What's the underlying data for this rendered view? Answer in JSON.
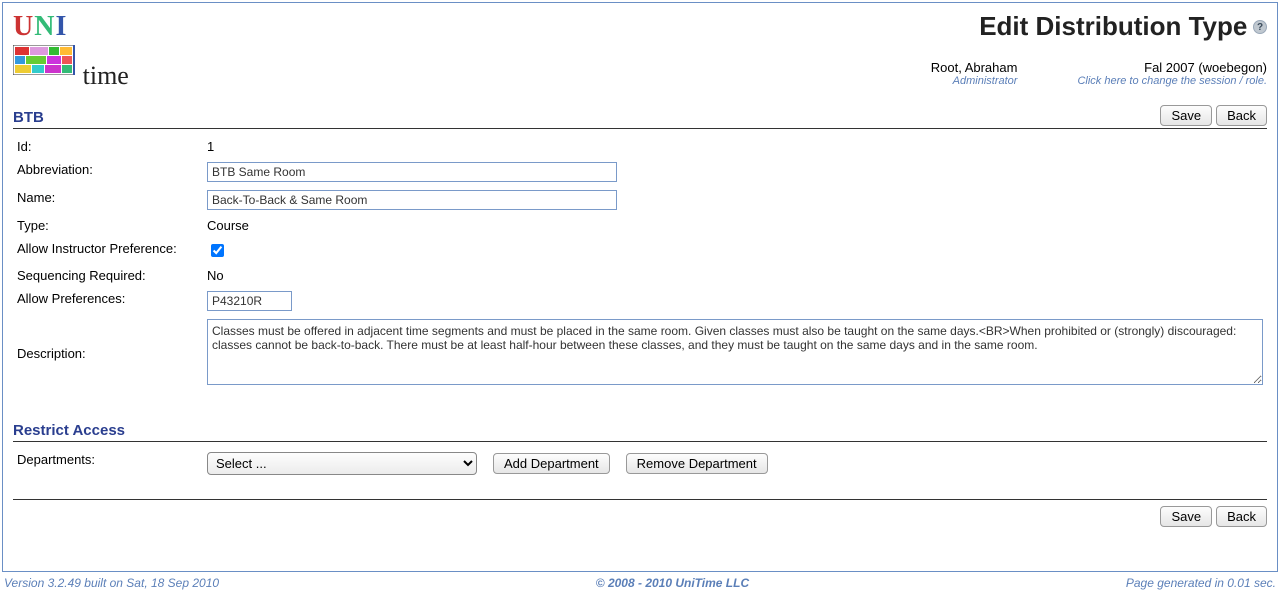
{
  "header": {
    "logo_letters": {
      "u": "U",
      "n": "N",
      "i": "I"
    },
    "time_word": "time",
    "page_title": "Edit Distribution Type",
    "help_glyph": "?",
    "user_name": "Root, Abraham",
    "user_role": "Administrator",
    "session_label": "Fal 2007 (woebegon)",
    "session_hint": "Click here to change the session / role."
  },
  "section": {
    "title": "BTB",
    "save_label": "Save",
    "back_label": "Back"
  },
  "form": {
    "id_label": "Id:",
    "id_value": "1",
    "abbr_label": "Abbreviation:",
    "abbr_value": "BTB Same Room",
    "name_label": "Name:",
    "name_value": "Back-To-Back & Same Room",
    "type_label": "Type:",
    "type_value": "Course",
    "allow_ipr_label": "Allow Instructor Preference:",
    "allow_ipr_checked": true,
    "seq_label": "Sequencing Required:",
    "seq_value": "No",
    "allow_prefs_label": "Allow Preferences:",
    "allow_prefs_value": "P43210R",
    "desc_label": "Description:",
    "desc_value": "Classes must be offered in adjacent time segments and must be placed in the same room. Given classes must also be taught on the same days.<BR>When prohibited or (strongly) discouraged: classes cannot be back-to-back. There must be at least half-hour between these classes, and they must be taught on the same days and in the same room."
  },
  "restrict": {
    "title": "Restrict Access",
    "dept_label": "Departments:",
    "select_placeholder": "Select ...",
    "add_label": "Add Department",
    "remove_label": "Remove Department"
  },
  "footer": {
    "version": "Version 3.2.49 built on Sat, 18 Sep 2010",
    "copyright": "© 2008 - 2010 UniTime LLC",
    "generated": "Page generated in 0.01 sec."
  }
}
